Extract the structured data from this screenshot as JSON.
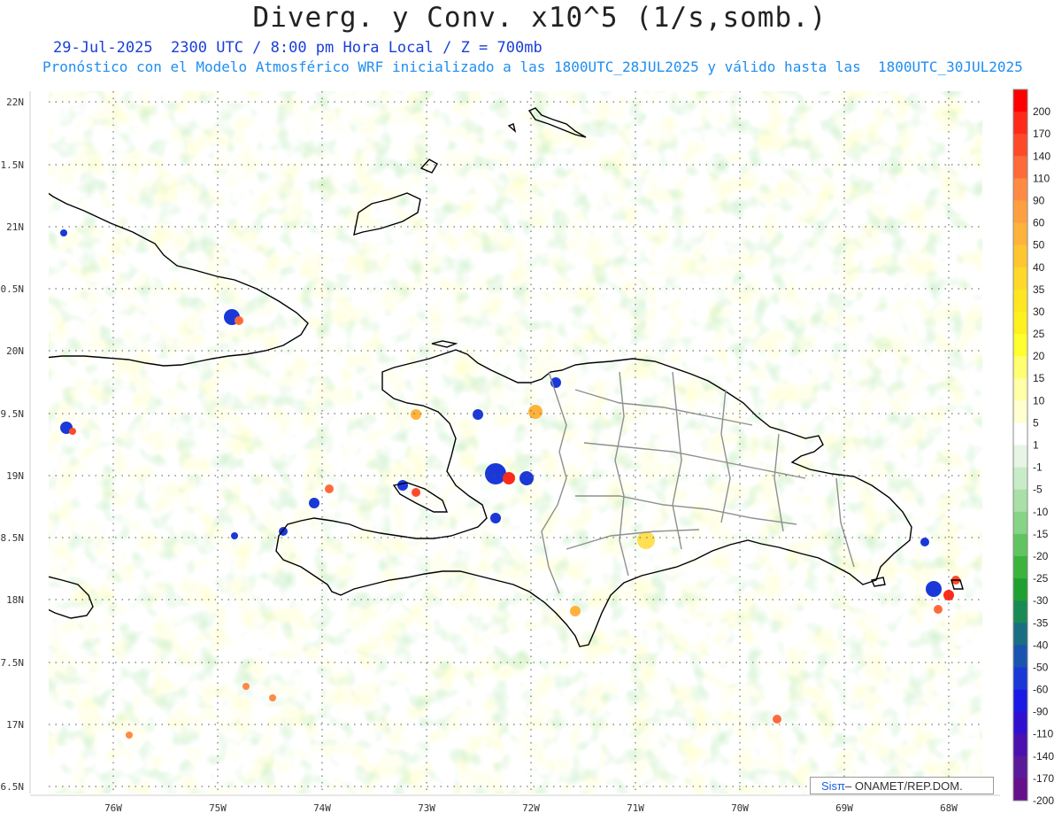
{
  "header": {
    "title": "Diverg. y Conv. x10^5 (1/s,somb.)",
    "subtitle_time": "29-Jul-2025  2300 UTC / 8:00 pm Hora Local / Z = 700mb",
    "subtitle_model": "Pronóstico con el Modelo Atmosférico WRF inicializado a las 1800UTC_28JUL2025 y válido hasta las  1800UTC_30JUL2025"
  },
  "map": {
    "lat_labels": [
      "22N",
      "1.5N",
      "21N",
      "0.5N",
      "20N",
      "9.5N",
      "19N",
      "8.5N",
      "18N",
      "7.5N",
      "17N",
      "6.5N"
    ],
    "lon_labels": [
      "76W",
      "75W",
      "74W",
      "73W",
      "72W",
      "71W",
      "70W",
      "69W",
      "68W"
    ]
  },
  "colorbar": {
    "labels": [
      "200",
      "170",
      "140",
      "110",
      "90",
      "60",
      "50",
      "40",
      "35",
      "30",
      "25",
      "20",
      "15",
      "10",
      "5",
      "1",
      "-1",
      "-5",
      "-10",
      "-15",
      "-20",
      "-25",
      "-30",
      "-35",
      "-40",
      "-50",
      "-60",
      "-90",
      "-110",
      "-140",
      "-170",
      "-200"
    ],
    "colors": [
      "#ff0000",
      "#ff2a1a",
      "#ff4a2a",
      "#ff6a3a",
      "#ff8a44",
      "#ffa040",
      "#ffb33a",
      "#ffc630",
      "#ffd829",
      "#ffe620",
      "#fff020",
      "#ffff30",
      "#ffff70",
      "#ffffa8",
      "#ffffd0",
      "#ffffff",
      "#e6f5e6",
      "#c8ecc8",
      "#a8e0a8",
      "#86d486",
      "#60c460",
      "#3cb43c",
      "#20a030",
      "#1a8a55",
      "#1a6e82",
      "#1a54b0",
      "#1a38d8",
      "#1a1ae6",
      "#3010d0",
      "#4a10b0",
      "#5a1a9a",
      "#66108a"
    ]
  },
  "credit": {
    "brand": "Sisπ",
    "text": "– ONAMET/REP.DOM."
  }
}
